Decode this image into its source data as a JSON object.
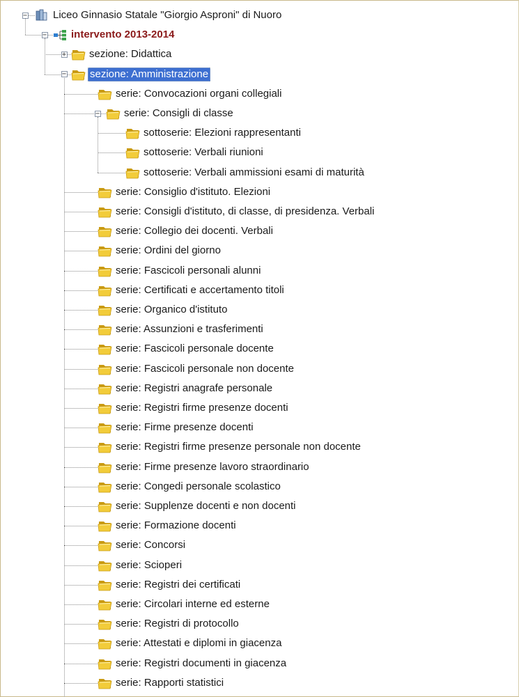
{
  "root": {
    "label": "Liceo Ginnasio Statale \"Giorgio Asproni\" di Nuoro",
    "icon": "library-icon"
  },
  "intervention": {
    "label": "intervento 2013-2014",
    "icon": "hierarchy-icon",
    "color": "#8b1a1a"
  },
  "sections": [
    {
      "label": "sezione: Didattica",
      "expanded": false
    },
    {
      "label": "sezione: Amministrazione",
      "expanded": true,
      "selected": true
    }
  ],
  "amministrazione_items": [
    {
      "label": "serie: Convocazioni organi collegiali"
    },
    {
      "label": "serie: Consigli di classe",
      "expanded": true,
      "children": [
        "sottoserie: Elezioni rappresentanti",
        "sottoserie: Verbali riunioni",
        "sottoserie: Verbali ammissioni esami di maturità"
      ]
    },
    {
      "label": "serie: Consiglio d'istituto. Elezioni"
    },
    {
      "label": "serie: Consigli d'istituto, di classe, di presidenza. Verbali"
    },
    {
      "label": "serie: Collegio dei docenti. Verbali"
    },
    {
      "label": "serie: Ordini del giorno"
    },
    {
      "label": "serie: Fascicoli personali alunni"
    },
    {
      "label": "serie: Certificati e accertamento titoli"
    },
    {
      "label": "serie: Organico d'istituto"
    },
    {
      "label": "serie: Assunzioni e trasferimenti"
    },
    {
      "label": "serie: Fascicoli personale docente"
    },
    {
      "label": "serie: Fascicoli personale non docente"
    },
    {
      "label": "serie: Registri anagrafe personale"
    },
    {
      "label": "serie: Registri firme presenze docenti"
    },
    {
      "label": "serie: Firme presenze docenti"
    },
    {
      "label": "serie: Registri firme presenze personale non docente"
    },
    {
      "label": "serie: Firme presenze lavoro straordinario"
    },
    {
      "label": "serie: Congedi personale scolastico"
    },
    {
      "label": "serie: Supplenze docenti e non docenti"
    },
    {
      "label": "serie: Formazione docenti"
    },
    {
      "label": "serie: Concorsi"
    },
    {
      "label": "serie: Scioperi"
    },
    {
      "label": "serie: Registri dei certificati"
    },
    {
      "label": "serie: Circolari interne ed esterne"
    },
    {
      "label": "serie: Registri di protocollo"
    },
    {
      "label": "serie: Attestati e diplomi in giacenza"
    },
    {
      "label": "serie: Registri documenti in giacenza"
    },
    {
      "label": "serie: Rapporti statistici"
    }
  ],
  "colors": {
    "selection": "#3d6fd1",
    "folder": "#f2cc3a",
    "folder_dark": "#c99a12",
    "tree_line": "#8a8a8a"
  }
}
